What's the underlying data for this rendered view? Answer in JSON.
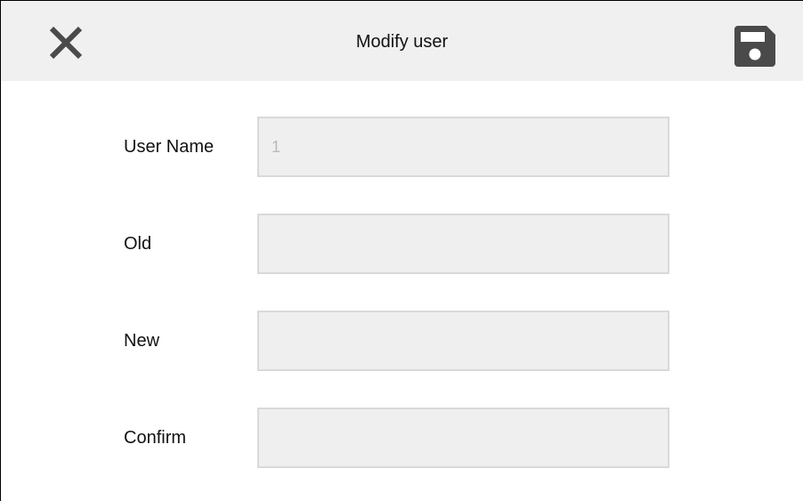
{
  "header": {
    "title": "Modify user",
    "close_icon": "close-icon",
    "save_icon": "save-icon"
  },
  "form": {
    "fields": [
      {
        "label": "User Name",
        "value": "1"
      },
      {
        "label": "Old",
        "value": ""
      },
      {
        "label": "New",
        "value": ""
      },
      {
        "label": "Confirm",
        "value": ""
      }
    ]
  },
  "colors": {
    "header_bg": "#f0f0f0",
    "icon": "#4a4a4a",
    "input_bg": "#efefef",
    "input_border": "#d9d9d9",
    "input_text": "#b9b9b9"
  }
}
